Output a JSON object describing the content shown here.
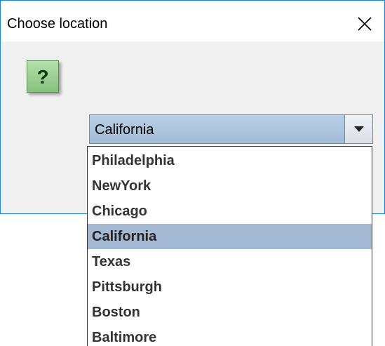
{
  "window": {
    "title": "Choose location",
    "close_icon": "close-icon",
    "border_color": "#1883d7"
  },
  "dialog": {
    "icon": "question-icon",
    "icon_glyph": "?",
    "icon_color": "#9dcf95"
  },
  "combo": {
    "selected_value": "California",
    "dropdown_icon": "chevron-down-icon",
    "accent": "#a4b9d3"
  },
  "dropdown_list": {
    "items": [
      {
        "label": "Philadelphia",
        "selected": false
      },
      {
        "label": "NewYork",
        "selected": false
      },
      {
        "label": "Chicago",
        "selected": false
      },
      {
        "label": "California",
        "selected": true
      },
      {
        "label": "Texas",
        "selected": false
      },
      {
        "label": "Pittsburgh",
        "selected": false
      },
      {
        "label": "Boston",
        "selected": false
      },
      {
        "label": "Baltimore",
        "selected": false
      }
    ]
  }
}
